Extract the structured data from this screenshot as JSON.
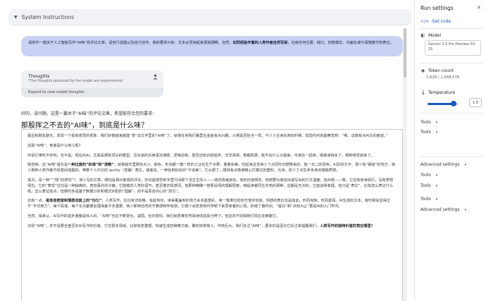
{
  "system_instructions": {
    "label": "System Instructions"
  },
  "user_prompt": {
    "text_before": "请你作一篇关于人工智能写作“AI味”的评论文章，请自行选题以及自行创作。我的要求只有：文本必须读起来很其顺畅、自然，",
    "text_bold": "如同经验丰富的人类作者自然写就",
    "text_after": "，杜绝任何生硬、拗口、刻意模仿、书面化或与语境脱节的表达。"
  },
  "thoughts": {
    "title": "Thoughts",
    "subtitle": "*The thoughts produced by the model are experimental",
    "expand_label": "Expand to view model thoughts"
  },
  "reply": {
    "intro": "好的，没问题。这是一篇关于“AI味”的评论文章，希望能符合您的要求：",
    "title": "那股挥之不去的“AI味”，到底是什么味？",
    "paragraphs": [
      {
        "text": "最近和朋友聊天，发现一个挺有意思的现象：我们好像越来越能“尝”出文字里的“AI味”了。就像往常我们嘴里在金鱼有点兴趣，火候是否恰当一样，不少人在读东西的时候，隐隐约约就能察觉到：“嗯，这篇有点AI写的痕迹。”"
      },
      {
        "text": "这股“AI味”，到底是什么味儿呢？"
      },
      {
        "text": "你说它难吃不好吧，也不是。现在的AI，尤其是那些顶尖的模型，写出来的东西语法通顺，逻辑清晰，甚至还知识经提供，洋洋洒洒，角看顾漂，挑不出什么大错来。可读在一起读，或者读得多了，那种感觉就来了。"
      },
      {
        "text": "我觉得，这“AI味”首先是",
        "bold": "一种过度的“标准”和“流畅”",
        "after": "。就像超市里那些大小、颜色、形状都一模一样的工业化生产水果，看着完美，吃起来总觉得少了点风吹日晒带来的、独一无二的风味。AI写的文字，很少有“破绽”的地方，缺少那种人类作者不经意间流露的、带着个人印记的 quirky（怪癖）表达，或者说，一种恰到好处的“不完美”。它太顺了，顺得有点像被精心打磨过的塑料，光滑，却少了点生命本身的粗糙质感。"
      },
      {
        "text": "其次，是一种“”“隔”的感觉”*。读人写的文章，哪怕是相对客观的评论，你也能感觉到字里行间那个活生生的人——他的情绪波动，他的价值倾向，他想要为谁说出或写出的行文温度。但AI呢——嗯，它没有亲身经历，没有爱憎情仇。它的“表现”往往是一种抽离的、宽容事外的冷静。它能模仿人类的语气，甚至模仿情感词，但那种精确一管那设情的理解层度，唤起读者同生共鸣的那种，这都是无法的。它能说得有理，但只是“表达”，比如怎么表达什么呢。怎么表达观点，但那时多是基于数据分析和模式匹配的“理解”，而不是原自内心的“洞见”。"
      },
      {
        "text": "还有一点，",
        "bold": "是信息密度和情感浓度上的“均匀”",
        "after": "。人类写作，往往有详有略，有起有伏。读来覆盖到的地方会浓墨重彩，读一笔带过的地方惜字如金。情感的表达也是如此，时而克制，时而激昂。AI生成的文本，有时候会显得过于“平均用力”，每个段落、每个论点都被处理得差不多重要，缺少那种自然的节奏感和呼吸感。它很少会愿意有时停顿下来思考者的心情，抑或了看时间，“留白”和“点到为止”更是AI的入门学问。"
      },
      {
        "text": "当然，得承认，AI写作的进步速度是惊人的。“AI味”也在不断变化，减弱。也许很快，我们就很难仅凭阅读体验来分辨了。但这并不妨碍我们现在去琢磨它。"
      },
      {
        "text": "识别“AI味”，并不是要全盘否定AI写作的价值。它在很多领域，比如信息整理、快速生成初稿等方面，确实效率惊人，作用巨大。我们关注“AI味”，更多的是因为它反过来提醒我们，",
        "bold": "人类写作的独特价值究竟在哪里？"
      }
    ]
  },
  "run_settings": {
    "title": "Run settings",
    "get_code_label": "Get code",
    "model_label": "Model",
    "model_value": "Gemini 2.5 Pro Preview 03-25",
    "token_count_label": "Token count",
    "token_count_value": "2,628 / 1,048,576",
    "temperature_label": "Temperature",
    "temperature_value": "1.5",
    "temperature_fraction": 0.75,
    "sections": [
      {
        "label": "Tools"
      },
      {
        "label": "Tools"
      },
      {
        "label": "Advanced settings"
      },
      {
        "label": "Tools"
      },
      {
        "label": "Tools"
      },
      {
        "label": "Tools"
      },
      {
        "label": "Tools"
      },
      {
        "label": "Advanced settings"
      }
    ]
  }
}
